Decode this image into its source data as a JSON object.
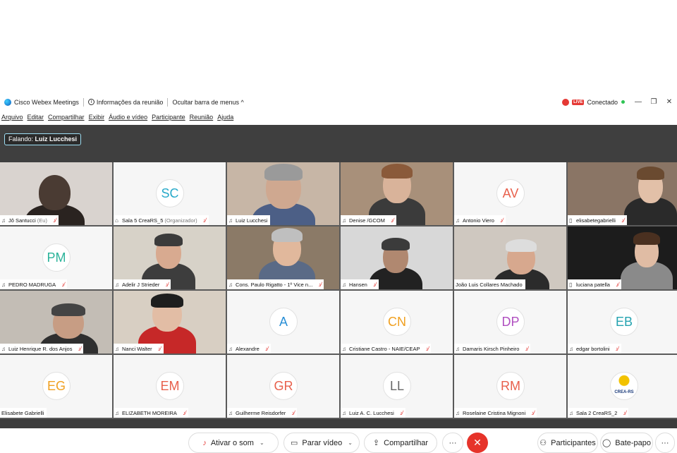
{
  "titlebar": {
    "app_name": "Cisco Webex Meetings",
    "meeting_info": "Informações da reunião",
    "hide_menu": "Ocultar barra de menus ^",
    "live_badge": "LIVE",
    "status": "Conectado",
    "status_color": "#2ec454"
  },
  "menu": {
    "items": [
      "Arquivo",
      "Editar",
      "Compartilhar",
      "Exibir",
      "Áudio e vídeo",
      "Participante",
      "Reunião",
      "Ajuda"
    ]
  },
  "speaking": {
    "prefix": "Falando:",
    "name": "Luiz Lucchesi"
  },
  "participants": [
    {
      "name": "Jô Santucci",
      "suffix": "(Eu)",
      "type": "video",
      "muted": true,
      "icon": "mic-icon"
    },
    {
      "name": "Sala 5 CreaRS_5",
      "suffix": "(Organizador)",
      "type": "avatar",
      "initials": "SC",
      "color": "#27a9c9",
      "muted": true,
      "icon": "device-icon"
    },
    {
      "name": "Luiz Lucchesi",
      "type": "video",
      "muted": false,
      "active": true,
      "icon": "mic-icon"
    },
    {
      "name": "Denise /GCOM",
      "type": "video",
      "muted": true,
      "icon": "mic-icon"
    },
    {
      "name": "Antonio Viero",
      "type": "avatar",
      "initials": "AV",
      "color": "#e8604c",
      "muted": true,
      "icon": "mic-icon"
    },
    {
      "name": "elisabetegabrielli",
      "type": "video",
      "muted": true,
      "icon": "phone-icon"
    },
    {
      "name": "PEDRO MADRUGA",
      "type": "avatar",
      "initials": "PM",
      "color": "#2bb39a",
      "muted": true,
      "icon": "mic-icon"
    },
    {
      "name": "Adelir J Strieder",
      "type": "video",
      "muted": true,
      "icon": "mic-icon"
    },
    {
      "name": "Cons. Paulo Rigatto - 1º Vice n...",
      "type": "video",
      "muted": true,
      "icon": "mic-icon"
    },
    {
      "name": "Hansen",
      "type": "video",
      "muted": true,
      "icon": "mic-icon"
    },
    {
      "name": "João Luis Collares Machado",
      "type": "video",
      "muted": false,
      "icon": "none"
    },
    {
      "name": "luciana patella",
      "type": "video",
      "muted": true,
      "icon": "phone-icon"
    },
    {
      "name": "Luiz Henrique R. dos Anjos",
      "type": "video",
      "muted": true,
      "icon": "mic-icon"
    },
    {
      "name": "Nanci Walter",
      "type": "video",
      "muted": true,
      "icon": "mic-icon"
    },
    {
      "name": "Alexandre",
      "type": "avatar",
      "initials": "A",
      "color": "#2a8fd6",
      "muted": true,
      "icon": "mic-icon"
    },
    {
      "name": "Cristiane Castro - NAIE/CEAP",
      "type": "avatar",
      "initials": "CN",
      "color": "#f0a020",
      "muted": true,
      "icon": "mic-icon"
    },
    {
      "name": "Damaris Kirsch Pinheiro",
      "type": "avatar",
      "initials": "DP",
      "color": "#b04fc0",
      "muted": true,
      "icon": "mic-icon"
    },
    {
      "name": "edgar bortolini",
      "type": "avatar",
      "initials": "EB",
      "color": "#25a3b0",
      "muted": true,
      "icon": "mic-icon"
    },
    {
      "name": "Elisabete Gabrielli",
      "type": "avatar",
      "initials": "EG",
      "color": "#f0a020",
      "muted": false,
      "icon": "none"
    },
    {
      "name": "ELIZABETH MOREIRA",
      "type": "avatar",
      "initials": "EM",
      "color": "#e8604c",
      "muted": true,
      "icon": "mic-icon"
    },
    {
      "name": "Guilherme Reisdorfer",
      "type": "avatar",
      "initials": "GR",
      "color": "#e8604c",
      "muted": true,
      "icon": "mic-icon"
    },
    {
      "name": "Luiz A. C. Lucchesi",
      "type": "avatar",
      "initials": "LL",
      "color": "#666666",
      "muted": true,
      "icon": "mic-icon"
    },
    {
      "name": "Roselaine Cristina Mignoni",
      "type": "avatar",
      "initials": "RM",
      "color": "#e8604c",
      "muted": true,
      "icon": "mic-icon"
    },
    {
      "name": "Sala 2 CreaRS_2",
      "type": "logo",
      "logo_text": "CREA-RS",
      "muted": true,
      "icon": "mic-icon"
    }
  ],
  "controls": {
    "mute_label": "Ativar o som",
    "video_label": "Parar vídeo",
    "share_label": "Compartilhar",
    "more_label": "···",
    "end_label": "✕",
    "participants_label": "Participantes",
    "chat_label": "Bate-papo",
    "overflow_label": "···"
  }
}
